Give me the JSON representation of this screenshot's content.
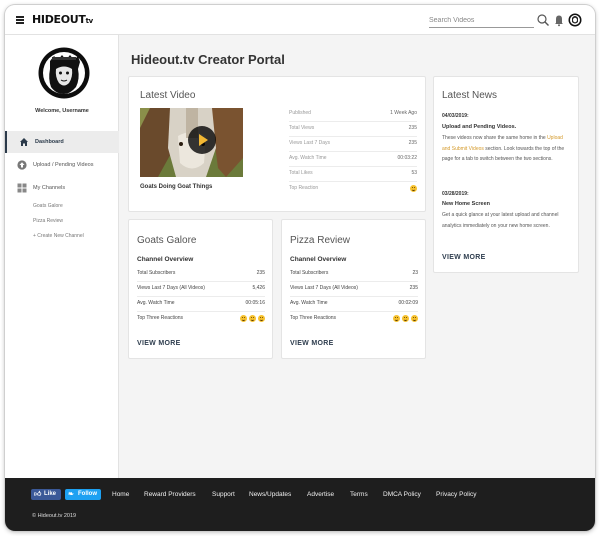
{
  "header": {
    "logo_text": "HIDEOUT",
    "logo_tv": "tv",
    "search_placeholder": "Search Videos",
    "icons": [
      "hamburger-icon",
      "search-icon",
      "bell-icon",
      "avatar-icon"
    ]
  },
  "sidebar": {
    "welcome": "Welcome, Username",
    "nav": [
      {
        "label": "Dashboard",
        "icon": "home-icon",
        "active": true
      },
      {
        "label": "Upload / Pending Videos",
        "icon": "upload-icon",
        "active": false
      },
      {
        "label": "My Channels",
        "icon": "grid-icon",
        "active": false
      }
    ],
    "channels": [
      "Goats Galore",
      "Pizza Review"
    ],
    "create_channel": "+ Create New Channel"
  },
  "main": {
    "page_title": "Hideout.tv Creator Portal",
    "latest_video": {
      "title": "Latest Video",
      "video_title": "Goats Doing Goat Things",
      "stats": [
        {
          "label": "Published",
          "value": "1 Week Ago"
        },
        {
          "label": "Total Views",
          "value": "235"
        },
        {
          "label": "Views Last 7 Days",
          "value": "235"
        },
        {
          "label": "Avg. Watch Time",
          "value": "00:03:22"
        },
        {
          "label": "Total Likes",
          "value": "53"
        },
        {
          "label": "Top Reaction",
          "value": ""
        }
      ]
    },
    "channels": [
      {
        "name": "Goats Galore",
        "overview": "Channel Overview",
        "stats": [
          {
            "label": "Total Subscribers",
            "value": "235"
          },
          {
            "label": "Views Last 7 Days (All Videos)",
            "value": "5,426"
          },
          {
            "label": "Avg. Watch Time",
            "value": "00:05:16"
          },
          {
            "label": "Top Three Reactions",
            "value": ""
          }
        ],
        "view_more": "VIEW MORE"
      },
      {
        "name": "Pizza Review",
        "overview": "Channel Overview",
        "stats": [
          {
            "label": "Total Subscribers",
            "value": "23"
          },
          {
            "label": "Views Last 7 Days (All Videos)",
            "value": "235"
          },
          {
            "label": "Avg. Watch Time",
            "value": "00:02:09"
          },
          {
            "label": "Top Three Reactions",
            "value": ""
          }
        ],
        "view_more": "VIEW MORE"
      }
    ],
    "news": {
      "title": "Latest News",
      "items": [
        {
          "date": "04/03/2019:",
          "headline": "Upload and Pending Videos.",
          "body_before": "These videos now share the same home in the ",
          "link": "Upload and Submit Videos",
          "body_after": " section. Look towards the top of the page for a tab to switch between the two sections."
        },
        {
          "date": "03/28/2019:",
          "headline": "New Home Screen",
          "body_before": "Get a quick glance at your latest upload and channel analytics immediately on your new home screen.",
          "link": "",
          "body_after": ""
        }
      ],
      "view_more": "VIEW MORE"
    }
  },
  "footer": {
    "like_label": "Like",
    "follow_label": "Follow",
    "links": [
      "Home",
      "Reward Providers",
      "Support",
      "News/Updates",
      "Advertise",
      "Terms",
      "DMCA Policy",
      "Privacy Policy"
    ],
    "copyright": "© Hideout.tv 2019"
  },
  "colors": {
    "accent_dark": "#2e3d4e",
    "link_orange": "#d49a2b",
    "facebook": "#3b5998",
    "twitter": "#1da1f2",
    "footer_bg": "#1e1e1e"
  }
}
